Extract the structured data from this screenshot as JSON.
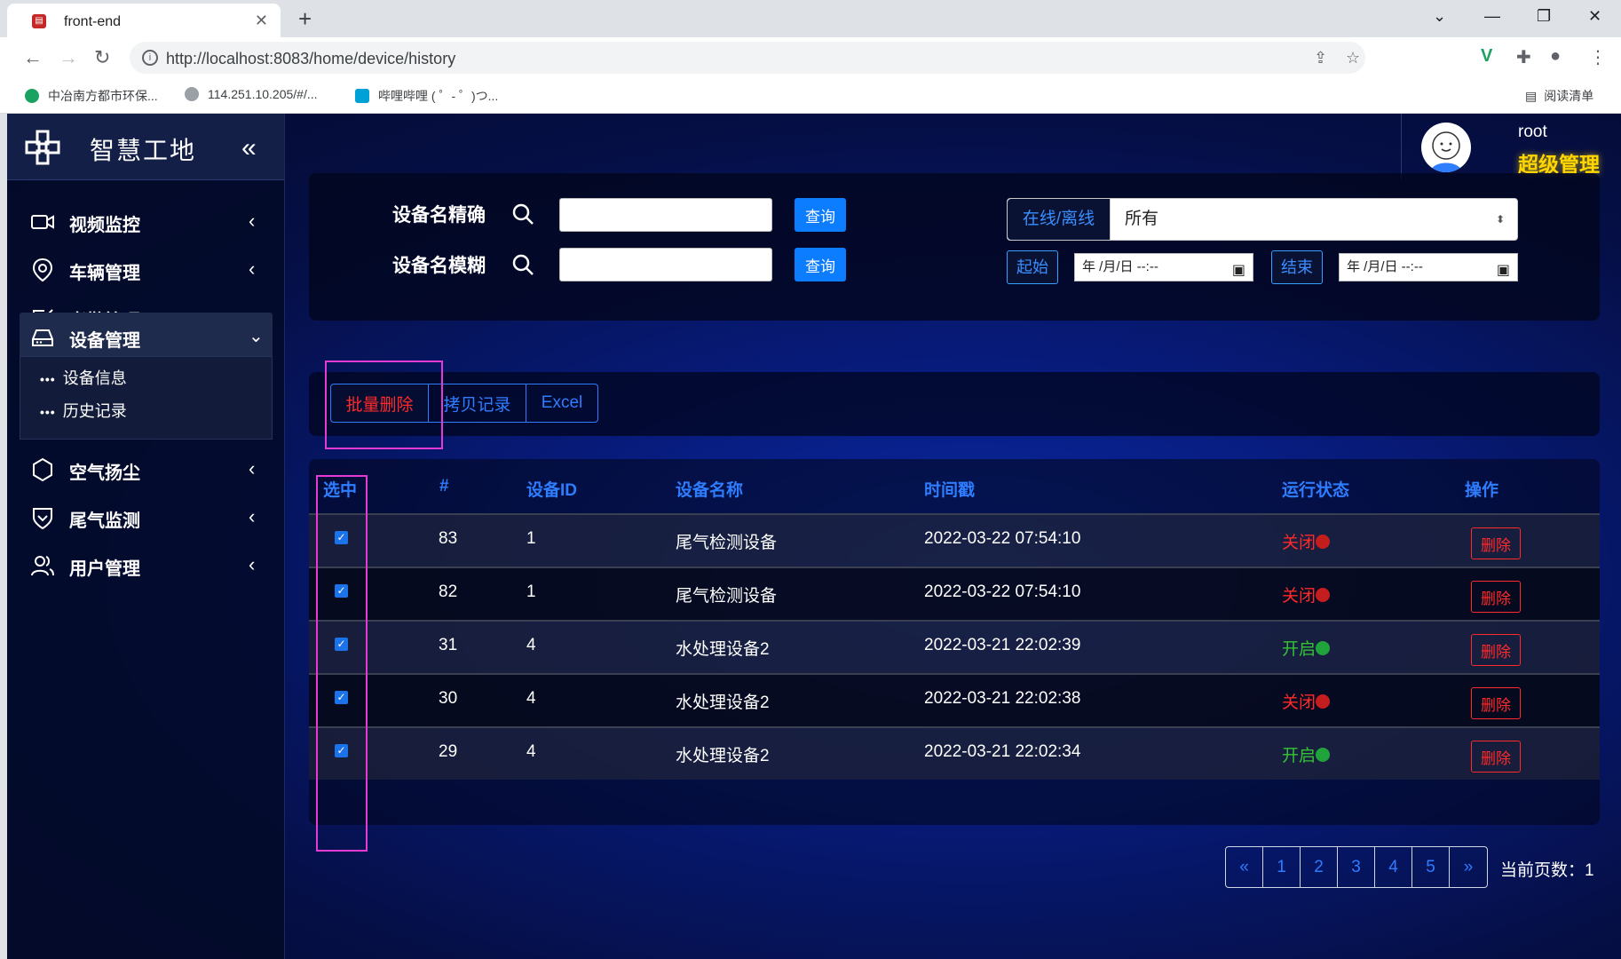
{
  "browser": {
    "tab_title": "front-end",
    "url": "http://localhost:8083/home/device/history",
    "bookmarks": [
      "中冶南方都市环保...",
      "114.251.10.205/#/...",
      "哔哩哔哩 ( ゜- ゜)つ..."
    ],
    "reading_list": "阅读清单"
  },
  "sidebar": {
    "brand": "智慧工地",
    "items": [
      {
        "label": "视频监控",
        "icon": "video-camera-icon"
      },
      {
        "label": "车辆管理",
        "icon": "location-pin-icon"
      },
      {
        "label": "考勤管理",
        "icon": "check-square-icon"
      },
      {
        "label": "设备管理",
        "icon": "device-drive-icon"
      },
      {
        "label": "空气扬尘",
        "icon": "hexagon-icon"
      },
      {
        "label": "尾气监测",
        "icon": "shield-heart-icon"
      },
      {
        "label": "用户管理",
        "icon": "users-icon"
      }
    ],
    "submenu": [
      "设备信息",
      "历史记录"
    ]
  },
  "user": {
    "name": "root",
    "role": "超级管理"
  },
  "search": {
    "exact_label": "设备名精确",
    "fuzzy_label": "设备名模糊",
    "query_btn": "查询",
    "status_tag": "在线/离线",
    "status_value": "所有",
    "start_tag": "起始",
    "end_tag": "结束",
    "date_placeholder": "年 /月/日 --:--"
  },
  "actions": {
    "batch_delete": "批量删除",
    "copy_records": "拷贝记录",
    "excel": "Excel"
  },
  "table": {
    "headers": [
      "选中",
      "#",
      "设备ID",
      "设备名称",
      "时间戳",
      "运行状态",
      "操作"
    ],
    "rows": [
      {
        "id": "83",
        "device_id": "1",
        "name": "尾气检测设备",
        "time": "2022-03-22 07:54:10",
        "status": "关闭",
        "on": false
      },
      {
        "id": "82",
        "device_id": "1",
        "name": "尾气检测设备",
        "time": "2022-03-22 07:54:10",
        "status": "关闭",
        "on": false
      },
      {
        "id": "31",
        "device_id": "4",
        "name": "水处理设备2",
        "time": "2022-03-21 22:02:39",
        "status": "开启",
        "on": true
      },
      {
        "id": "30",
        "device_id": "4",
        "name": "水处理设备2",
        "time": "2022-03-21 22:02:38",
        "status": "关闭",
        "on": false
      },
      {
        "id": "29",
        "device_id": "4",
        "name": "水处理设备2",
        "time": "2022-03-21 22:02:34",
        "status": "开启",
        "on": true
      }
    ],
    "delete_btn": "删除"
  },
  "pagination": {
    "prev": "«",
    "pages": [
      "1",
      "2",
      "3",
      "4",
      "5"
    ],
    "next": "»",
    "current_label": "当前页数：1"
  },
  "colors": {
    "accent": "#2f7dff",
    "off": "#ff2a2a",
    "on": "#35c335",
    "role": "#ffd600",
    "highlight": "#e53ad4"
  }
}
